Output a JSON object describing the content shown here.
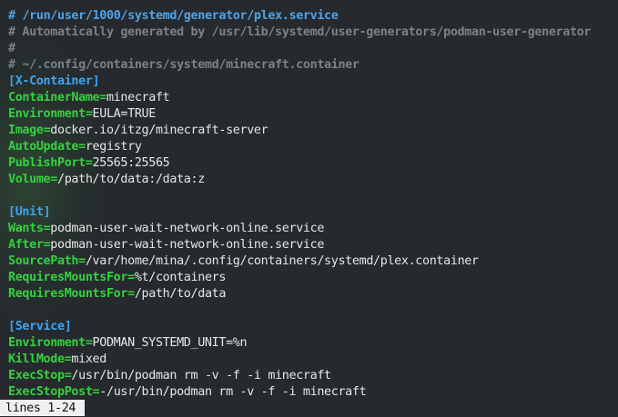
{
  "header": {
    "hash": "#",
    "path": "/run/user/1000/systemd/generator/plex.service"
  },
  "comments": [
    "# Automatically generated by /usr/lib/systemd/user-generators/podman-user-generator",
    "#",
    "# ~/.config/containers/systemd/minecraft.container"
  ],
  "sections": {
    "container": "[X-Container]",
    "unit": "[Unit]",
    "service": "[Service]"
  },
  "container_entries": [
    {
      "key": "ContainerName=",
      "value": "minecraft"
    },
    {
      "key": "Environment=",
      "value": "EULA=TRUE"
    },
    {
      "key": "Image=",
      "value": "docker.io/itzg/minecraft-server"
    },
    {
      "key": "AutoUpdate=",
      "value": "registry"
    },
    {
      "key": "PublishPort=",
      "value": "25565:25565"
    },
    {
      "key": "Volume=",
      "value": "/path/to/data:/data:z"
    }
  ],
  "unit_entries": [
    {
      "key": "Wants=",
      "value": "podman-user-wait-network-online.service"
    },
    {
      "key": "After=",
      "value": "podman-user-wait-network-online.service"
    },
    {
      "key": "SourcePath=",
      "value": "/var/home/mina/.config/containers/systemd/plex.container"
    },
    {
      "key": "RequiresMountsFor=",
      "value": "%t/containers"
    },
    {
      "key": "RequiresMountsFor=",
      "value": "/path/to/data"
    }
  ],
  "service_entries": [
    {
      "key": "Environment=",
      "value": "PODMAN_SYSTEMD_UNIT=%n"
    },
    {
      "key": "KillMode=",
      "value": "mixed"
    },
    {
      "key": "ExecStop=",
      "value": "/usr/bin/podman rm -v -f -i minecraft"
    },
    {
      "key": "ExecStopPost=",
      "value": "-/usr/bin/podman rm -v -f -i minecraft"
    }
  ],
  "status_bar": {
    "text": "lines 1-24"
  },
  "colors": {
    "background": "#262a2e",
    "key": "#34d13f",
    "section": "#3fa3f0",
    "comment": "#7a8288",
    "value": "#e6e6e6",
    "status_bg": "#f0f0f0"
  }
}
